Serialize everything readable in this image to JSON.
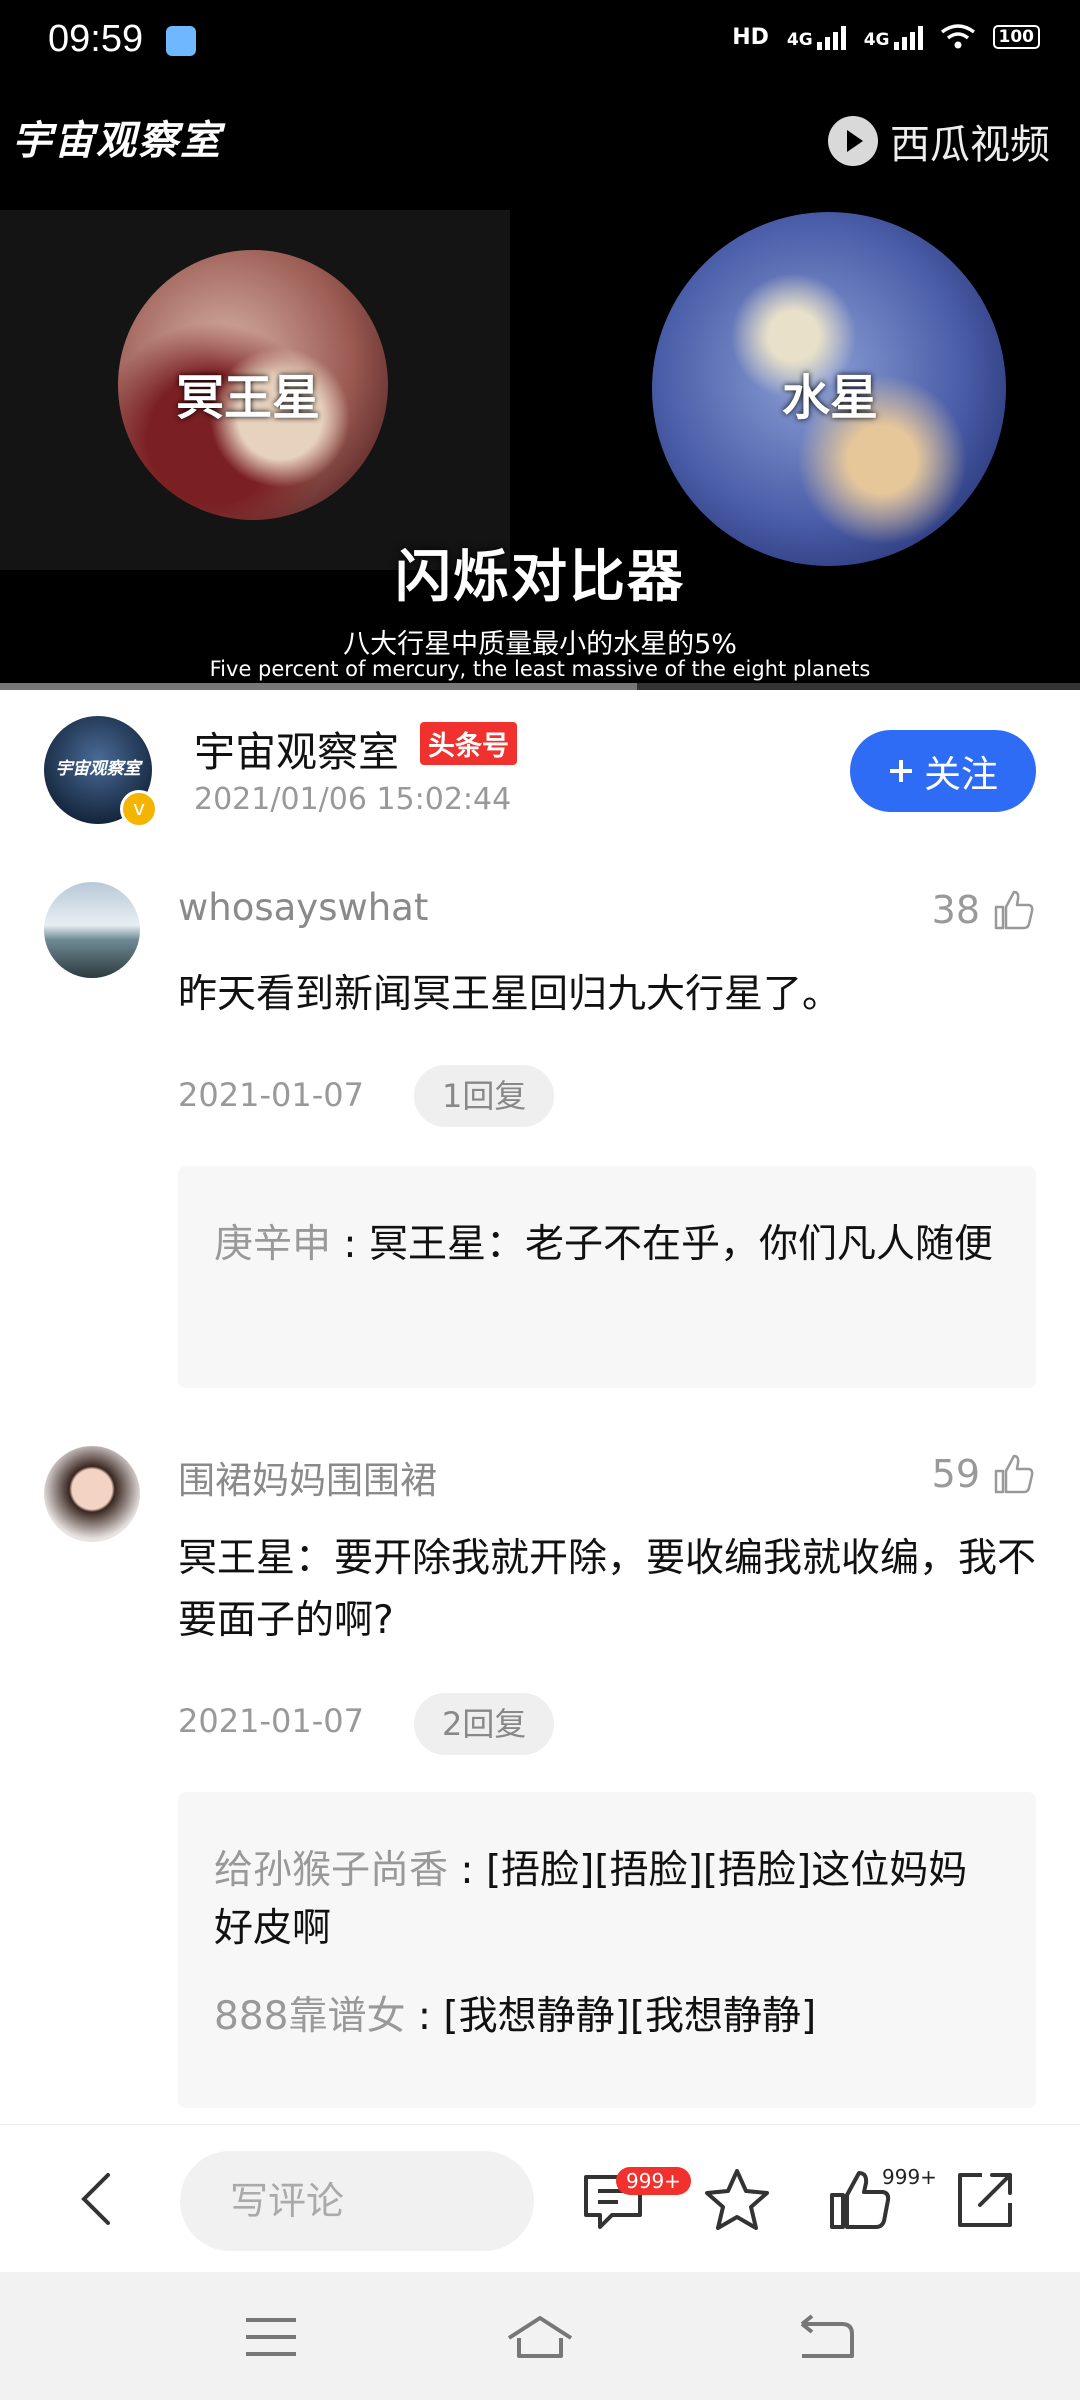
{
  "status_bar": {
    "time": "09:59",
    "network": [
      "HD",
      "4G",
      "4G"
    ],
    "battery": "100"
  },
  "video": {
    "channel_watermark": "宇宙观察室",
    "platform_watermark": "西瓜视频",
    "planet_left_label": "冥王星",
    "planet_right_label": "水星",
    "title_overlay": "闪烁对比器",
    "subtitle_cn": "八大行星中质量最小的水星的5%",
    "subtitle_en": "Five percent of mercury, the least massive of the eight planets",
    "progress_fraction": 0.53,
    "buffered_fraction": 0.59
  },
  "publisher": {
    "name": "宇宙观察室",
    "avatar_text": "宇宙观察室",
    "tag": "头条号",
    "datetime": "2021/01/06 15:02:44",
    "follow_label": "关注"
  },
  "comments": [
    {
      "user": "whosayswhat",
      "likes": "38",
      "text": "昨天看到新闻冥王星回归九大行星了。",
      "date": "2021-01-07",
      "replies_label": "1回复",
      "replies": [
        {
          "user": "庚辛申",
          "text": "冥王星：老子不在乎，你们凡人随便"
        }
      ]
    },
    {
      "user": "围裙妈妈围围裙",
      "likes": "59",
      "text": "冥王星：要开除我就开除，要收编我就收编，我不要面子的啊?",
      "date": "2021-01-07",
      "replies_label": "2回复",
      "replies": [
        {
          "user": "给孙猴子尚香",
          "text": "[捂脸][捂脸][捂脸]这位妈妈好皮啊"
        },
        {
          "user": "888靠谱女",
          "text": "[我想静静][我想静静]"
        }
      ]
    }
  ],
  "action_bar": {
    "comment_placeholder": "写评论",
    "comment_count": "999+",
    "like_count": "999+",
    "icons": [
      "back-icon",
      "comment-icon",
      "star-icon",
      "thumb-up-icon",
      "share-icon"
    ]
  },
  "system_nav": {
    "icons": [
      "menu-icon",
      "home-icon",
      "back-icon"
    ]
  },
  "colors": {
    "accent": "#2f6cf5",
    "tag_red": "#f0312d",
    "badge_gold": "#f5b400"
  }
}
